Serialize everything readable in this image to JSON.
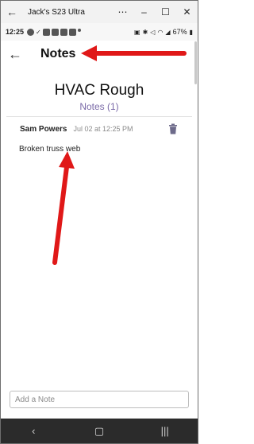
{
  "window": {
    "title": "Jack's S23 Ultra"
  },
  "statusbar": {
    "time": "12:25",
    "battery": "67%"
  },
  "appbar": {
    "title": "Notes"
  },
  "job": {
    "name": "HVAC Rough",
    "notes_count_label": "Notes (1)"
  },
  "notes": [
    {
      "author": "Sam Powers",
      "time": "Jul 02 at 12:25 PM",
      "text": "Broken truss web"
    }
  ],
  "composer": {
    "placeholder": "Add a Note"
  },
  "colors": {
    "accent": "#7b6ba8",
    "annotation": "#e01818",
    "navbar": "#2b2b2b"
  },
  "icons": [
    "back-arrow-icon",
    "trash-icon",
    "nav-back-icon",
    "nav-home-icon",
    "nav-recents-icon"
  ]
}
